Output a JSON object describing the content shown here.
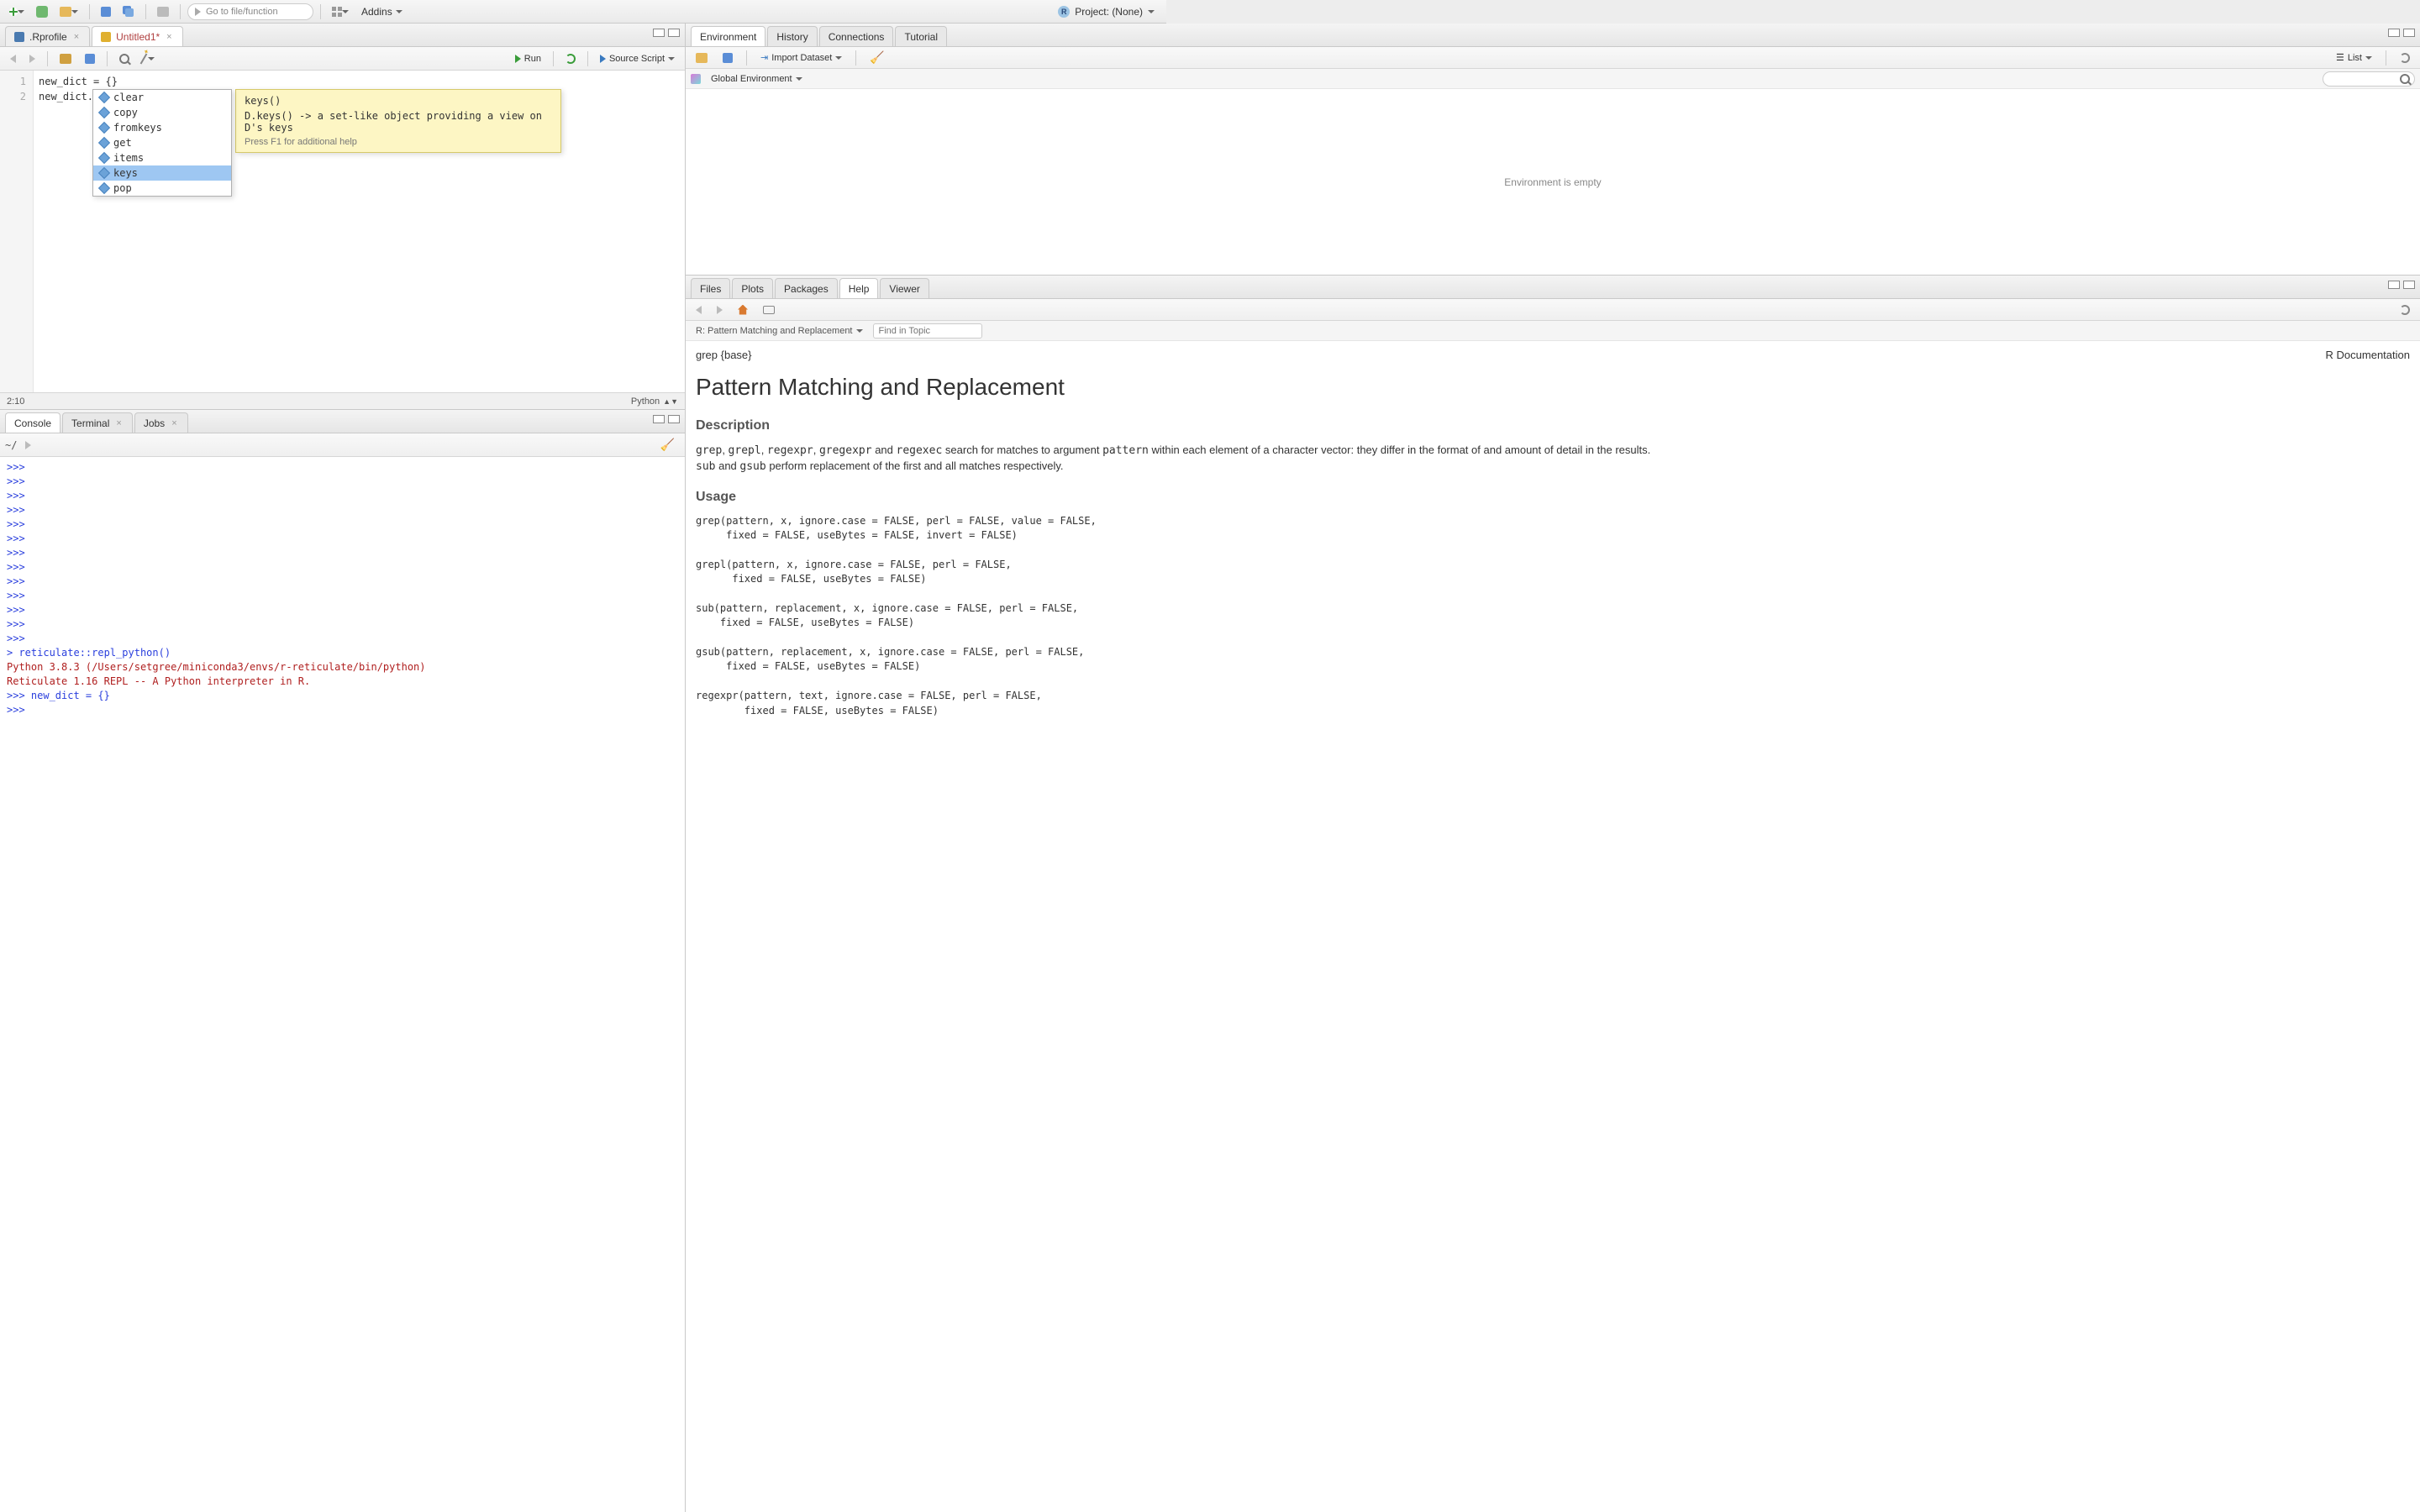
{
  "toolbar": {
    "goto_placeholder": "Go to file/function",
    "addins": "Addins",
    "project_label": "Project: (None)"
  },
  "editor": {
    "tabs": [
      {
        "label": ".Rprofile",
        "dirty": false,
        "icon": "rprof"
      },
      {
        "label": "Untitled1*",
        "dirty": true,
        "icon": "py"
      }
    ],
    "active_tab": 1,
    "run": "Run",
    "source": "Source Script",
    "lines": [
      "new_dict = {}",
      "new_dict."
    ],
    "cursor": "2:10",
    "language": "Python"
  },
  "autocomplete": {
    "items": [
      "clear",
      "copy",
      "fromkeys",
      "get",
      "items",
      "keys",
      "pop"
    ],
    "selected": 5
  },
  "tooltip": {
    "signature": "keys()",
    "doc": "D.keys() -> a set-like object providing a view on D's keys",
    "hint": "Press F1 for additional help"
  },
  "console": {
    "tabs": [
      "Console",
      "Terminal",
      "Jobs"
    ],
    "active": 0,
    "prompt_path": "~/",
    "lines": [
      {
        "t": "py",
        "s": ">>> "
      },
      {
        "t": "py",
        "s": ">>> "
      },
      {
        "t": "py",
        "s": ">>> "
      },
      {
        "t": "py",
        "s": ">>> "
      },
      {
        "t": "py",
        "s": ">>> "
      },
      {
        "t": "py",
        "s": ">>> "
      },
      {
        "t": "py",
        "s": ">>> "
      },
      {
        "t": "py",
        "s": ">>> "
      },
      {
        "t": "py",
        "s": ">>> "
      },
      {
        "t": "py",
        "s": ">>> "
      },
      {
        "t": "py",
        "s": ">>> "
      },
      {
        "t": "py",
        "s": ">>> "
      },
      {
        "t": "py",
        "s": ">>> "
      },
      {
        "t": "r",
        "s": "> reticulate::repl_python()"
      },
      {
        "t": "err",
        "s": "Python 3.8.3 (/Users/setgree/miniconda3/envs/r-reticulate/bin/python)"
      },
      {
        "t": "err",
        "s": "Reticulate 1.16 REPL -- A Python interpreter in R."
      },
      {
        "t": "py",
        "s": ">>> new_dict = {}"
      },
      {
        "t": "py",
        "s": ">>> "
      }
    ]
  },
  "env": {
    "tabs": [
      "Environment",
      "History",
      "Connections",
      "Tutorial"
    ],
    "active": 0,
    "import": "Import Dataset",
    "list": "List",
    "scope": "Global Environment",
    "empty": "Environment is empty"
  },
  "help": {
    "tabs": [
      "Files",
      "Plots",
      "Packages",
      "Help",
      "Viewer"
    ],
    "active": 3,
    "breadcrumb": "R: Pattern Matching and Replacement",
    "find_placeholder": "Find in Topic",
    "topic_left": "grep {base}",
    "topic_right": "R Documentation",
    "title": "Pattern Matching and Replacement",
    "sec_desc": "Description",
    "desc_html": "grep, grepl, regexpr, gregexpr and regexec search for matches to argument pattern within each element of a character vector: they differ in the format of and amount of detail in the results.",
    "desc2_html": "sub and gsub perform replacement of the first and all matches respectively.",
    "sec_usage": "Usage",
    "usage": "grep(pattern, x, ignore.case = FALSE, perl = FALSE, value = FALSE,\n     fixed = FALSE, useBytes = FALSE, invert = FALSE)\n\ngrepl(pattern, x, ignore.case = FALSE, perl = FALSE,\n      fixed = FALSE, useBytes = FALSE)\n\nsub(pattern, replacement, x, ignore.case = FALSE, perl = FALSE,\n    fixed = FALSE, useBytes = FALSE)\n\ngsub(pattern, replacement, x, ignore.case = FALSE, perl = FALSE,\n     fixed = FALSE, useBytes = FALSE)\n\nregexpr(pattern, text, ignore.case = FALSE, perl = FALSE,\n        fixed = FALSE, useBytes = FALSE)"
  }
}
